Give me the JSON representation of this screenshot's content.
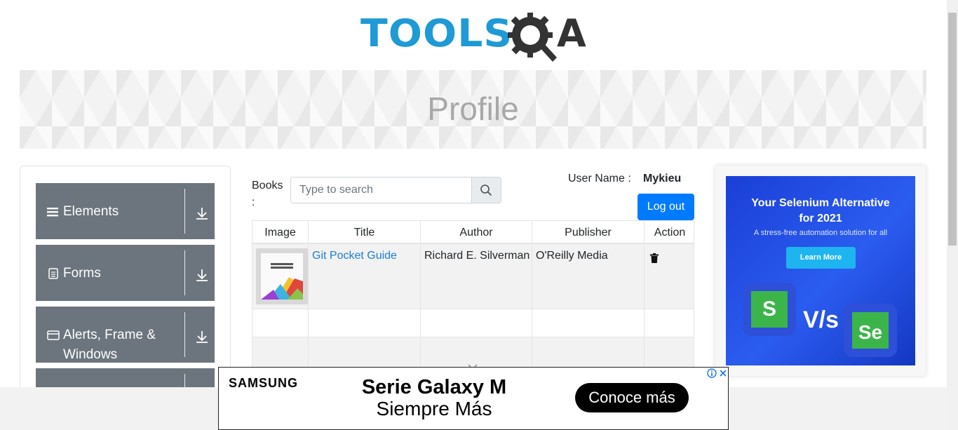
{
  "logo": {
    "text_left": "TOOLS",
    "text_right": "A",
    "icon": "gear-magnifier-q-icon"
  },
  "banner": {
    "title": "Profile"
  },
  "sidebar": {
    "groups": [
      {
        "label": "Elements",
        "icon": "hamburger-icon"
      },
      {
        "label": "Forms",
        "icon": "document-icon"
      },
      {
        "label": "Alerts, Frame & Windows",
        "icon": "window-icon"
      }
    ]
  },
  "books": {
    "label": "Books :",
    "search_placeholder": "Type to search"
  },
  "user": {
    "label": "User Name :",
    "name": "Mykieu",
    "logout_label": "Log out"
  },
  "table": {
    "headers": [
      "Image",
      "Title",
      "Author",
      "Publisher",
      "Action"
    ],
    "rows": [
      {
        "title": "Git Pocket Guide",
        "author": "Richard E. Silverman",
        "publisher": "O'Reilly Media"
      }
    ]
  },
  "right_ad": {
    "headline_1": "Your Selenium Alternative",
    "headline_2": "for 2021",
    "sub": "A stress-free automation solution for all",
    "button": "Learn More",
    "vs": "V/s",
    "left_logo": "S",
    "right_logo": "Se"
  },
  "bottom_ad": {
    "brand": "SAMSUNG",
    "line1": "Serie Galaxy M",
    "line2": "Siempre Más",
    "cta": "Conoce más"
  },
  "colors": {
    "accent": "#007bff",
    "sidebar": "#6c757d",
    "link": "#1c7ed6",
    "logo_blue": "#1e9ad6"
  }
}
